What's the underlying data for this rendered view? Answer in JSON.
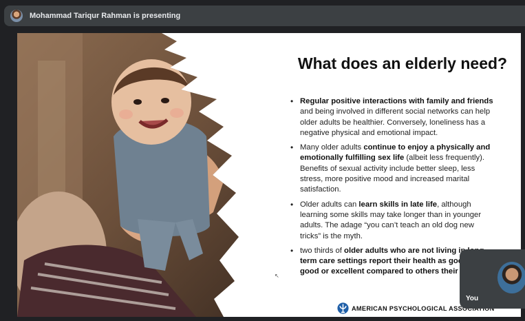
{
  "meeting": {
    "presenter_text": "Mohammad Tariqur Rahman is presenting",
    "self_label": "You"
  },
  "slide": {
    "title": "What does an elderly need?",
    "bullets": [
      {
        "segments": [
          {
            "text": "Regular positive interactions with family and friends",
            "bold": true
          },
          {
            "text": " and being involved in different social networks can help older adults be healthier. Conversely, loneliness has a negative physical and emotional impact.",
            "bold": false
          }
        ]
      },
      {
        "segments": [
          {
            "text": "Many older adults ",
            "bold": false
          },
          {
            "text": "continue to enjoy a physically and emotionally fulfilling sex life",
            "bold": true
          },
          {
            "text": " (albeit less frequently). Benefits of sexual activity include better sleep, less stress, more positive mood and increased marital satisfaction.",
            "bold": false
          }
        ]
      },
      {
        "segments": [
          {
            "text": "Older adults can ",
            "bold": false
          },
          {
            "text": "learn skills in late life",
            "bold": true
          },
          {
            "text": ", although learning some skills may take longer than in younger adults. The adage “you can’t teach an old dog new tricks” is the myth.",
            "bold": false
          }
        ]
      },
      {
        "segments": [
          {
            "text": "two thirds of ",
            "bold": false
          },
          {
            "text": "older adults who are not living in long-term care settings report their health as good, very good or excellent compared to others their age",
            "bold": true
          },
          {
            "text": ".",
            "bold": false
          }
        ]
      }
    ],
    "footer_org": "AMERICAN PSYCHOLOGICAL ASSOCIATION",
    "logo_icon": "psi-icon"
  },
  "colors": {
    "app_background": "#202124",
    "bar_background": "#3c4043",
    "apa_blue": "#1f5fa8"
  }
}
